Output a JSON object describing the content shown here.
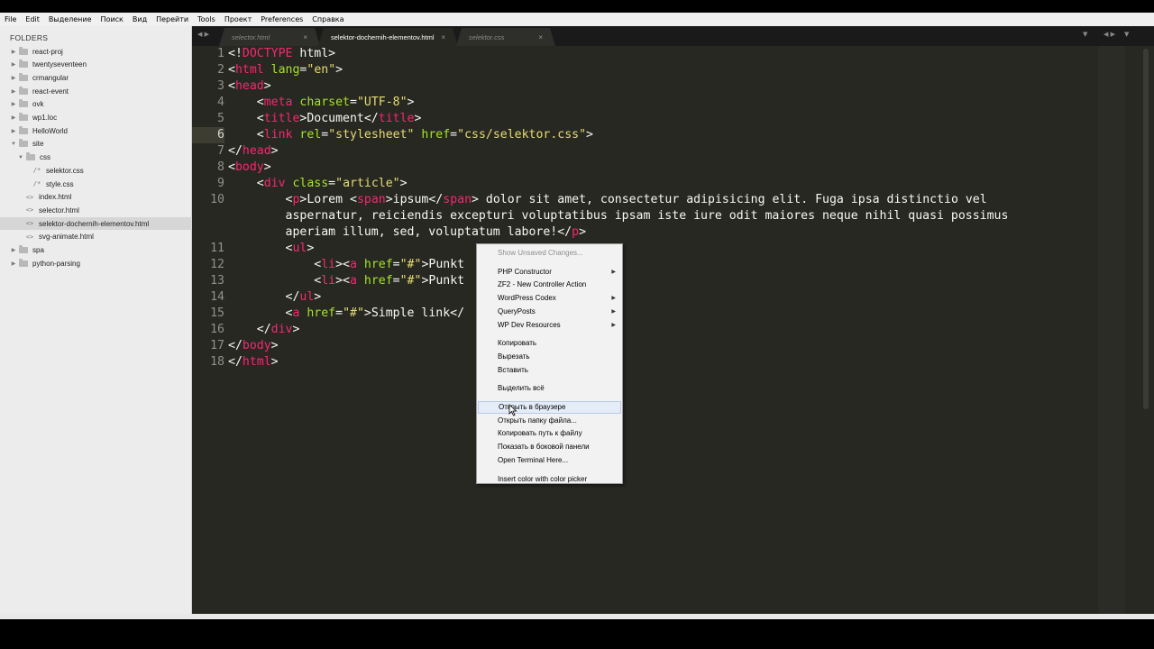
{
  "menubar": [
    "File",
    "Edit",
    "Выделение",
    "Поиск",
    "Вид",
    "Перейти",
    "Tools",
    "Проект",
    "Preferences",
    "Справка"
  ],
  "sidebar": {
    "title": "FOLDERS",
    "items": [
      {
        "label": "react-proj",
        "kind": "folder",
        "depth": 0,
        "open": false
      },
      {
        "label": "twentyseventeen",
        "kind": "folder",
        "depth": 0,
        "open": false
      },
      {
        "label": "crmangular",
        "kind": "folder",
        "depth": 0,
        "open": false
      },
      {
        "label": "react-event",
        "kind": "folder",
        "depth": 0,
        "open": false
      },
      {
        "label": "ovk",
        "kind": "folder",
        "depth": 0,
        "open": false
      },
      {
        "label": "wp1.loc",
        "kind": "folder",
        "depth": 0,
        "open": false
      },
      {
        "label": "HelloWorld",
        "kind": "folder",
        "depth": 0,
        "open": false
      },
      {
        "label": "site",
        "kind": "folder",
        "depth": 0,
        "open": true
      },
      {
        "label": "css",
        "kind": "folder",
        "depth": 1,
        "open": true
      },
      {
        "label": "selektor.css",
        "kind": "css",
        "depth": 2
      },
      {
        "label": "style.css",
        "kind": "css",
        "depth": 2
      },
      {
        "label": "index.html",
        "kind": "html",
        "depth": 1
      },
      {
        "label": "selector.html",
        "kind": "html",
        "depth": 1
      },
      {
        "label": "selektor-dochernih-elementov.html",
        "kind": "html",
        "depth": 1,
        "active": true
      },
      {
        "label": "svg-animate.html",
        "kind": "html",
        "depth": 1
      },
      {
        "label": "spa",
        "kind": "folder",
        "depth": 0,
        "open": false
      },
      {
        "label": "python-parsing",
        "kind": "folder",
        "depth": 0,
        "open": false
      }
    ]
  },
  "tabs": [
    {
      "label": "selector.html",
      "active": false
    },
    {
      "label": "selektor-dochernih-elementov.html",
      "active": true
    },
    {
      "label": "selektor.css",
      "active": false
    }
  ],
  "editor": {
    "current_line": "6",
    "line_numbers": [
      "1",
      "2",
      "3",
      "4",
      "5",
      "6",
      "7",
      "8",
      "9",
      "10",
      "",
      "",
      "11",
      "12",
      "13",
      "14",
      "15",
      "16",
      "17",
      "18"
    ],
    "lines": [
      [
        [
          "p",
          "<!"
        ],
        [
          "t",
          "DOCTYPE"
        ],
        [
          "p",
          " html>"
        ]
      ],
      [
        [
          "p",
          "<"
        ],
        [
          "t",
          "html"
        ],
        [
          "a",
          " lang"
        ],
        [
          "p",
          "="
        ],
        [
          "s",
          "\"en\""
        ],
        [
          "p",
          ">"
        ]
      ],
      [
        [
          "p",
          "<"
        ],
        [
          "t",
          "head"
        ],
        [
          "p",
          ">"
        ]
      ],
      [
        [
          "p",
          "    <"
        ],
        [
          "t",
          "meta"
        ],
        [
          "a",
          " charset"
        ],
        [
          "p",
          "="
        ],
        [
          "s",
          "\"UTF-8\""
        ],
        [
          "p",
          ">"
        ]
      ],
      [
        [
          "p",
          "    <"
        ],
        [
          "t",
          "title"
        ],
        [
          "p",
          ">Document</"
        ],
        [
          "t",
          "title"
        ],
        [
          "p",
          ">"
        ]
      ],
      [
        [
          "p",
          "    <"
        ],
        [
          "t",
          "link"
        ],
        [
          "a",
          " rel"
        ],
        [
          "p",
          "="
        ],
        [
          "s",
          "\"stylesheet\""
        ],
        [
          "a",
          " href"
        ],
        [
          "p",
          "="
        ],
        [
          "s",
          "\"css/selektor.css\""
        ],
        [
          "p",
          ">"
        ]
      ],
      [
        [
          "p",
          "</"
        ],
        [
          "t",
          "head"
        ],
        [
          "p",
          ">"
        ]
      ],
      [
        [
          "p",
          "<"
        ],
        [
          "t",
          "body"
        ],
        [
          "p",
          ">"
        ]
      ],
      [
        [
          "p",
          "    <"
        ],
        [
          "t",
          "div"
        ],
        [
          "a",
          " class"
        ],
        [
          "p",
          "="
        ],
        [
          "s",
          "\"article\""
        ],
        [
          "p",
          ">"
        ]
      ],
      [
        [
          "p",
          "        <"
        ],
        [
          "t",
          "p"
        ],
        [
          "p",
          ">Lorem <"
        ],
        [
          "t",
          "span"
        ],
        [
          "p",
          ">ipsum</"
        ],
        [
          "t",
          "span"
        ],
        [
          "p",
          "> dolor sit amet, consectetur adipisicing elit. Fuga ipsa distinctio vel"
        ]
      ],
      [
        [
          "p",
          "        aspernatur, reiciendis excepturi voluptatibus ipsam iste iure odit maiores neque nihil quasi possimus"
        ]
      ],
      [
        [
          "p",
          "        aperiam illum, sed, voluptatum labore!</"
        ],
        [
          "t",
          "p"
        ],
        [
          "p",
          ">"
        ]
      ],
      [
        [
          "p",
          "        <"
        ],
        [
          "t",
          "ul"
        ],
        [
          "p",
          ">"
        ]
      ],
      [
        [
          "p",
          "            <"
        ],
        [
          "t",
          "li"
        ],
        [
          "p",
          "><"
        ],
        [
          "t",
          "a"
        ],
        [
          "a",
          " href"
        ],
        [
          "p",
          "="
        ],
        [
          "s",
          "\"#\""
        ],
        [
          "p",
          ">Punkt"
        ]
      ],
      [
        [
          "p",
          "            <"
        ],
        [
          "t",
          "li"
        ],
        [
          "p",
          "><"
        ],
        [
          "t",
          "a"
        ],
        [
          "a",
          " href"
        ],
        [
          "p",
          "="
        ],
        [
          "s",
          "\"#\""
        ],
        [
          "p",
          ">Punkt"
        ]
      ],
      [
        [
          "p",
          "        </"
        ],
        [
          "t",
          "ul"
        ],
        [
          "p",
          ">"
        ]
      ],
      [
        [
          "p",
          "        <"
        ],
        [
          "t",
          "a"
        ],
        [
          "a",
          " href"
        ],
        [
          "p",
          "="
        ],
        [
          "s",
          "\"#\""
        ],
        [
          "p",
          ">Simple link</"
        ]
      ],
      [
        [
          "p",
          "    </"
        ],
        [
          "t",
          "div"
        ],
        [
          "p",
          ">"
        ]
      ],
      [
        [
          "p",
          "</"
        ],
        [
          "t",
          "body"
        ],
        [
          "p",
          ">"
        ]
      ],
      [
        [
          "p",
          "</"
        ],
        [
          "t",
          "html"
        ],
        [
          "p",
          ">"
        ]
      ]
    ]
  },
  "context_menu": {
    "items": [
      {
        "label": "Show Unsaved Changes...",
        "disabled": true
      },
      {
        "sep": true
      },
      {
        "label": "PHP Constructor",
        "submenu": true
      },
      {
        "label": "ZF2 - New Controller Action"
      },
      {
        "label": "WordPress Codex",
        "submenu": true
      },
      {
        "label": "QueryPosts",
        "submenu": true
      },
      {
        "label": "WP Dev Resources",
        "submenu": true
      },
      {
        "sep": true
      },
      {
        "label": "Копировать"
      },
      {
        "label": "Вырезать"
      },
      {
        "label": "Вставить"
      },
      {
        "sep": true
      },
      {
        "label": "Выделить всё"
      },
      {
        "sep": true
      },
      {
        "label": "Открыть в браузере",
        "hover": true
      },
      {
        "label": "Открыть папку файла..."
      },
      {
        "label": "Копировать путь к файлу"
      },
      {
        "label": "Показать в боковой панели"
      },
      {
        "label": "Open Terminal Here..."
      },
      {
        "sep": true
      },
      {
        "label": "Insert color with color picker"
      }
    ]
  },
  "icons": {
    "arrow_right": "▶",
    "arrow_down": "▼",
    "html": "<>",
    "css": "/*",
    "close": "×",
    "submenu": "▶",
    "nav": "◀ ▶",
    "dropdown": "▼"
  }
}
